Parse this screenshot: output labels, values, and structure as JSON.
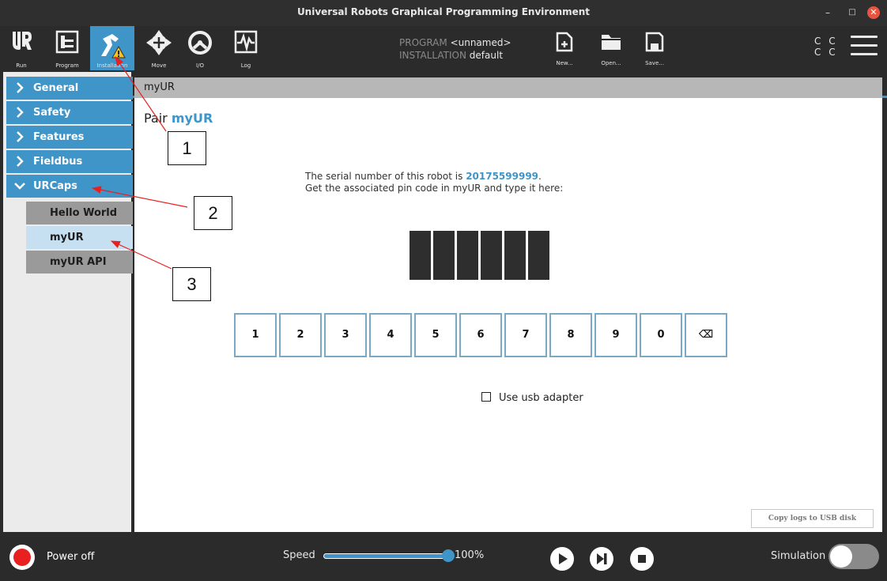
{
  "window": {
    "title": "Universal Robots Graphical Programming Environment",
    "minimize": "–",
    "maximize": "□",
    "close": "✕"
  },
  "toolbar": {
    "run": "Run",
    "program": "Program",
    "installation": "Installation",
    "move": "Move",
    "io": "I/O",
    "log": "Log",
    "program_key": "PROGRAM",
    "program_value": "<unnamed>",
    "installation_key": "INSTALLATION",
    "installation_value": "default",
    "new": "New...",
    "open": "Open...",
    "save": "Save...",
    "cc_top": "C C",
    "cc_bottom": "C C"
  },
  "sidebar": {
    "items": [
      {
        "label": "General"
      },
      {
        "label": "Safety"
      },
      {
        "label": "Features"
      },
      {
        "label": "Fieldbus"
      },
      {
        "label": "URCaps"
      }
    ],
    "subitems": [
      {
        "label": "Hello World"
      },
      {
        "label": "myUR"
      },
      {
        "label": "myUR API"
      }
    ]
  },
  "main": {
    "header": "myUR",
    "pair_prefix": "Pair",
    "pair_name": "myUR",
    "serial_prefix": "The serial number of this robot is",
    "serial_number": "20175599999",
    "serial_suffix": ".",
    "pin_instruction": "Get the associated pin code in myUR and type it here:",
    "keys": [
      "1",
      "2",
      "3",
      "4",
      "5",
      "6",
      "7",
      "8",
      "9",
      "0",
      "⌫"
    ],
    "usb_label": "Use usb adapter",
    "copy_logs": "Copy logs to USB disk"
  },
  "bottom": {
    "power_label": "Power off",
    "speed_label": "Speed",
    "speed_value": "100%",
    "speed_fraction": 1.0,
    "simulation_label": "Simulation"
  },
  "annotations": [
    "1",
    "2",
    "3"
  ],
  "colors": {
    "accent": "#3f94c8",
    "power": "#e8201f",
    "warning": "#f5c518"
  }
}
